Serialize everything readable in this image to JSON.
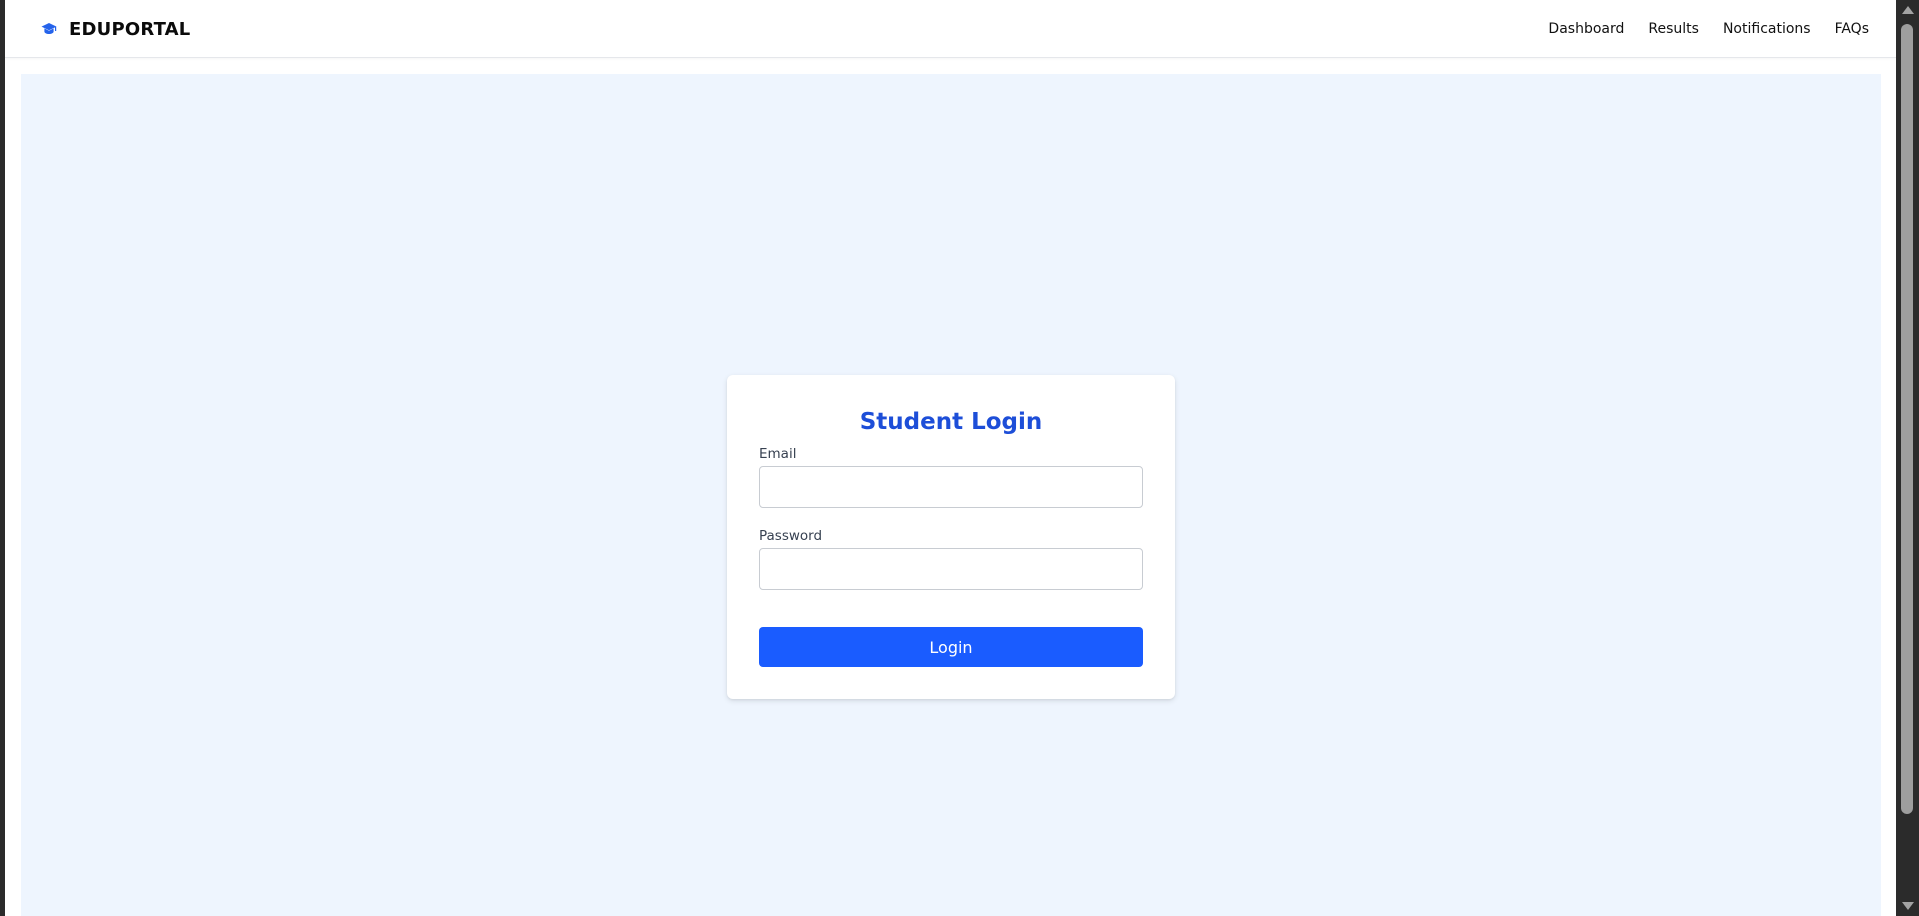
{
  "header": {
    "brand_name": "EDUPORTAL",
    "brand_icon": "graduation-cap-icon",
    "nav_items": [
      "Dashboard",
      "Results",
      "Notifications",
      "FAQs"
    ]
  },
  "login": {
    "title": "Student Login",
    "email_label": "Email",
    "email_value": "",
    "password_label": "Password",
    "password_value": "",
    "submit_label": "Login"
  },
  "colors": {
    "accent": "#1a5cff",
    "title": "#1d4ed8",
    "icon": "#2563eb",
    "page_background": "#eef5fe"
  }
}
